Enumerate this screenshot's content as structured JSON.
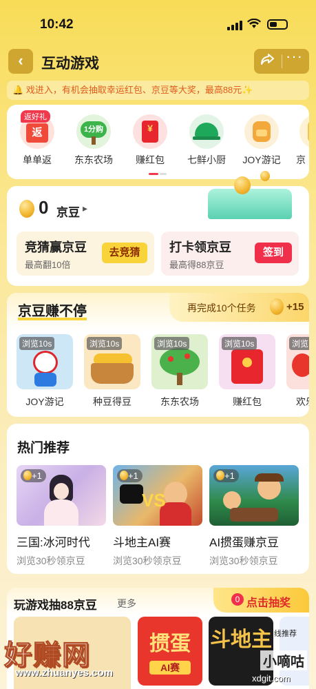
{
  "status": {
    "time": "10:42"
  },
  "nav": {
    "title": "互动游戏",
    "back_icon": "‹",
    "share_icon": "share-icon",
    "more_icon": "···"
  },
  "notice": {
    "text": "戏进入，有机会抽取幸运红包、京豆等大奖，最高88元✨"
  },
  "entries": [
    {
      "label": "单单返",
      "badge": "返好礼",
      "glyph": "返",
      "color": "#f04b3a"
    },
    {
      "label": "东东农场",
      "glyph": "1分购",
      "color": "#3cb44a"
    },
    {
      "label": "赚红包",
      "glyph": "¥",
      "color": "#e8262d"
    },
    {
      "label": "七鲜小厨",
      "glyph": "",
      "color": "#1ea85a"
    },
    {
      "label": "JOY游记",
      "glyph": "",
      "color": "#f2a83a"
    },
    {
      "label": "京",
      "glyph": "",
      "color": "#f6c34a"
    }
  ],
  "beans": {
    "count": "0",
    "unit": "京豆",
    "arrow": "▸"
  },
  "tasks": [
    {
      "title": "竞猜赢京豆",
      "sub": "最高翻10倍",
      "button": "去竞猜",
      "btn_bg": "#f8d43a",
      "btn_color": "#8a2b00",
      "bg": "#fdf4df"
    },
    {
      "title": "打卡领京豆",
      "sub": "最高得88京豆",
      "button": "签到",
      "btn_bg": "#f0304a",
      "btn_color": "#ffffff",
      "bg": "#fdeeee"
    }
  ],
  "earn": {
    "title": "京豆赚不停",
    "progress_text": "再完成10个任务",
    "reward": "+15",
    "items": [
      {
        "tag": "浏览10s",
        "label": "JOY游记",
        "bg": "#cde7f7"
      },
      {
        "tag": "浏览10s",
        "label": "种豆得豆",
        "bg": "#fbe7c2"
      },
      {
        "tag": "浏览10s",
        "label": "东东农场",
        "bg": "#dff0cf"
      },
      {
        "tag": "浏览10s",
        "label": "赚红包",
        "bg": "#f6dff0"
      },
      {
        "tag": "浏览",
        "label": "欢乐",
        "bg": "#fbe0dc"
      }
    ]
  },
  "hot": {
    "title": "热门推荐",
    "items": [
      {
        "tag": "+1",
        "title": "三国:冰河时代",
        "sub": "浏览30秒领京豆"
      },
      {
        "tag": "+1",
        "title": "斗地主AI赛",
        "sub": "浏览30秒领京豆"
      },
      {
        "tag": "+1",
        "title": "AI掼蛋赚京豆",
        "sub": "浏览30秒领京豆"
      }
    ]
  },
  "bottom": {
    "title": "玩游戏抽88京豆",
    "more": "更多",
    "lottery_count": "0",
    "lottery": "点击抽奖",
    "game1": "掼蛋",
    "game1_sub": "AI赛",
    "game2": "斗地主",
    "game3_tag": "线推荐"
  },
  "watermark": {
    "left": "好赚网",
    "url": "www.zhuanyes.com",
    "right": "小嘀咕",
    "right_url": "xdgit.com"
  }
}
